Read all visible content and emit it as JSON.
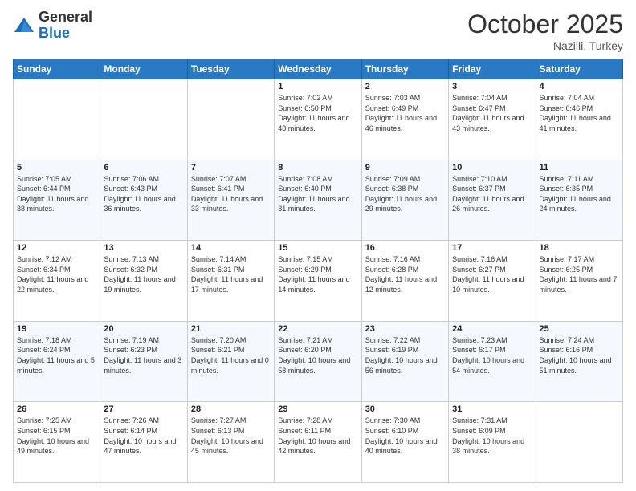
{
  "logo": {
    "general": "General",
    "blue": "Blue"
  },
  "header": {
    "month_year": "October 2025",
    "location": "Nazilli, Turkey"
  },
  "days_of_week": [
    "Sunday",
    "Monday",
    "Tuesday",
    "Wednesday",
    "Thursday",
    "Friday",
    "Saturday"
  ],
  "weeks": [
    [
      {
        "day": "",
        "info": ""
      },
      {
        "day": "",
        "info": ""
      },
      {
        "day": "",
        "info": ""
      },
      {
        "day": "1",
        "info": "Sunrise: 7:02 AM\nSunset: 6:50 PM\nDaylight: 11 hours and 48 minutes."
      },
      {
        "day": "2",
        "info": "Sunrise: 7:03 AM\nSunset: 6:49 PM\nDaylight: 11 hours and 46 minutes."
      },
      {
        "day": "3",
        "info": "Sunrise: 7:04 AM\nSunset: 6:47 PM\nDaylight: 11 hours and 43 minutes."
      },
      {
        "day": "4",
        "info": "Sunrise: 7:04 AM\nSunset: 6:46 PM\nDaylight: 11 hours and 41 minutes."
      }
    ],
    [
      {
        "day": "5",
        "info": "Sunrise: 7:05 AM\nSunset: 6:44 PM\nDaylight: 11 hours and 38 minutes."
      },
      {
        "day": "6",
        "info": "Sunrise: 7:06 AM\nSunset: 6:43 PM\nDaylight: 11 hours and 36 minutes."
      },
      {
        "day": "7",
        "info": "Sunrise: 7:07 AM\nSunset: 6:41 PM\nDaylight: 11 hours and 33 minutes."
      },
      {
        "day": "8",
        "info": "Sunrise: 7:08 AM\nSunset: 6:40 PM\nDaylight: 11 hours and 31 minutes."
      },
      {
        "day": "9",
        "info": "Sunrise: 7:09 AM\nSunset: 6:38 PM\nDaylight: 11 hours and 29 minutes."
      },
      {
        "day": "10",
        "info": "Sunrise: 7:10 AM\nSunset: 6:37 PM\nDaylight: 11 hours and 26 minutes."
      },
      {
        "day": "11",
        "info": "Sunrise: 7:11 AM\nSunset: 6:35 PM\nDaylight: 11 hours and 24 minutes."
      }
    ],
    [
      {
        "day": "12",
        "info": "Sunrise: 7:12 AM\nSunset: 6:34 PM\nDaylight: 11 hours and 22 minutes."
      },
      {
        "day": "13",
        "info": "Sunrise: 7:13 AM\nSunset: 6:32 PM\nDaylight: 11 hours and 19 minutes."
      },
      {
        "day": "14",
        "info": "Sunrise: 7:14 AM\nSunset: 6:31 PM\nDaylight: 11 hours and 17 minutes."
      },
      {
        "day": "15",
        "info": "Sunrise: 7:15 AM\nSunset: 6:29 PM\nDaylight: 11 hours and 14 minutes."
      },
      {
        "day": "16",
        "info": "Sunrise: 7:16 AM\nSunset: 6:28 PM\nDaylight: 11 hours and 12 minutes."
      },
      {
        "day": "17",
        "info": "Sunrise: 7:16 AM\nSunset: 6:27 PM\nDaylight: 11 hours and 10 minutes."
      },
      {
        "day": "18",
        "info": "Sunrise: 7:17 AM\nSunset: 6:25 PM\nDaylight: 11 hours and 7 minutes."
      }
    ],
    [
      {
        "day": "19",
        "info": "Sunrise: 7:18 AM\nSunset: 6:24 PM\nDaylight: 11 hours and 5 minutes."
      },
      {
        "day": "20",
        "info": "Sunrise: 7:19 AM\nSunset: 6:23 PM\nDaylight: 11 hours and 3 minutes."
      },
      {
        "day": "21",
        "info": "Sunrise: 7:20 AM\nSunset: 6:21 PM\nDaylight: 11 hours and 0 minutes."
      },
      {
        "day": "22",
        "info": "Sunrise: 7:21 AM\nSunset: 6:20 PM\nDaylight: 10 hours and 58 minutes."
      },
      {
        "day": "23",
        "info": "Sunrise: 7:22 AM\nSunset: 6:19 PM\nDaylight: 10 hours and 56 minutes."
      },
      {
        "day": "24",
        "info": "Sunrise: 7:23 AM\nSunset: 6:17 PM\nDaylight: 10 hours and 54 minutes."
      },
      {
        "day": "25",
        "info": "Sunrise: 7:24 AM\nSunset: 6:16 PM\nDaylight: 10 hours and 51 minutes."
      }
    ],
    [
      {
        "day": "26",
        "info": "Sunrise: 7:25 AM\nSunset: 6:15 PM\nDaylight: 10 hours and 49 minutes."
      },
      {
        "day": "27",
        "info": "Sunrise: 7:26 AM\nSunset: 6:14 PM\nDaylight: 10 hours and 47 minutes."
      },
      {
        "day": "28",
        "info": "Sunrise: 7:27 AM\nSunset: 6:13 PM\nDaylight: 10 hours and 45 minutes."
      },
      {
        "day": "29",
        "info": "Sunrise: 7:28 AM\nSunset: 6:11 PM\nDaylight: 10 hours and 42 minutes."
      },
      {
        "day": "30",
        "info": "Sunrise: 7:30 AM\nSunset: 6:10 PM\nDaylight: 10 hours and 40 minutes."
      },
      {
        "day": "31",
        "info": "Sunrise: 7:31 AM\nSunset: 6:09 PM\nDaylight: 10 hours and 38 minutes."
      },
      {
        "day": "",
        "info": ""
      }
    ]
  ]
}
